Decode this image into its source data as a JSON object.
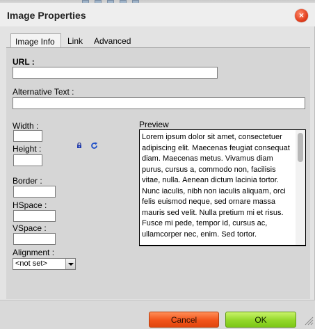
{
  "dialog": {
    "title": "Image Properties",
    "close_glyph": "×"
  },
  "tabs": [
    {
      "label": "Image Info",
      "active": true
    },
    {
      "label": "Link",
      "active": false
    },
    {
      "label": "Advanced",
      "active": false
    }
  ],
  "form": {
    "url_label": "URL :",
    "url_value": "",
    "alt_label": "Alternative Text :",
    "alt_value": "",
    "width_label": "Width :",
    "width_value": "",
    "height_label": "Height :",
    "height_value": "",
    "border_label": "Border :",
    "border_value": "",
    "hspace_label": "HSpace :",
    "hspace_value": "",
    "vspace_label": "VSpace :",
    "vspace_value": "",
    "alignment_label": "Alignment :",
    "alignment_value": "<not set>"
  },
  "icons": {
    "lock": "lock-icon",
    "reset": "refresh-icon",
    "close": "close-icon",
    "resize": "resize-grip-icon"
  },
  "preview": {
    "label": "Preview",
    "text": "Lorem ipsum dolor sit amet, consectetuer adipiscing elit. Maecenas feugiat consequat diam. Maecenas metus. Vivamus diam purus, cursus a, commodo non, facilisis vitae, nulla. Aenean dictum lacinia tortor. Nunc iaculis, nibh non iaculis aliquam, orci felis euismod neque, sed ornare massa mauris sed velit. Nulla pretium mi et risus. Fusce mi pede, tempor id, cursus ac, ullamcorper nec, enim. Sed tortor."
  },
  "buttons": {
    "cancel": "Cancel",
    "ok": "OK"
  },
  "colors": {
    "cancel": "#f2541a",
    "ok": "#93d82a",
    "close": "#e2401f"
  }
}
